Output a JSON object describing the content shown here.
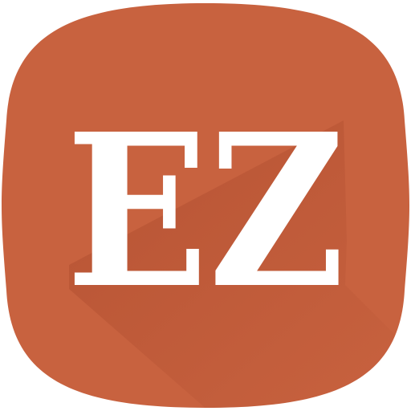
{
  "app_icon": {
    "logo_text": "EZ",
    "colors": {
      "background": "#c8623f",
      "long_shadow": "#a9482b",
      "letters": "#ffffff"
    }
  }
}
